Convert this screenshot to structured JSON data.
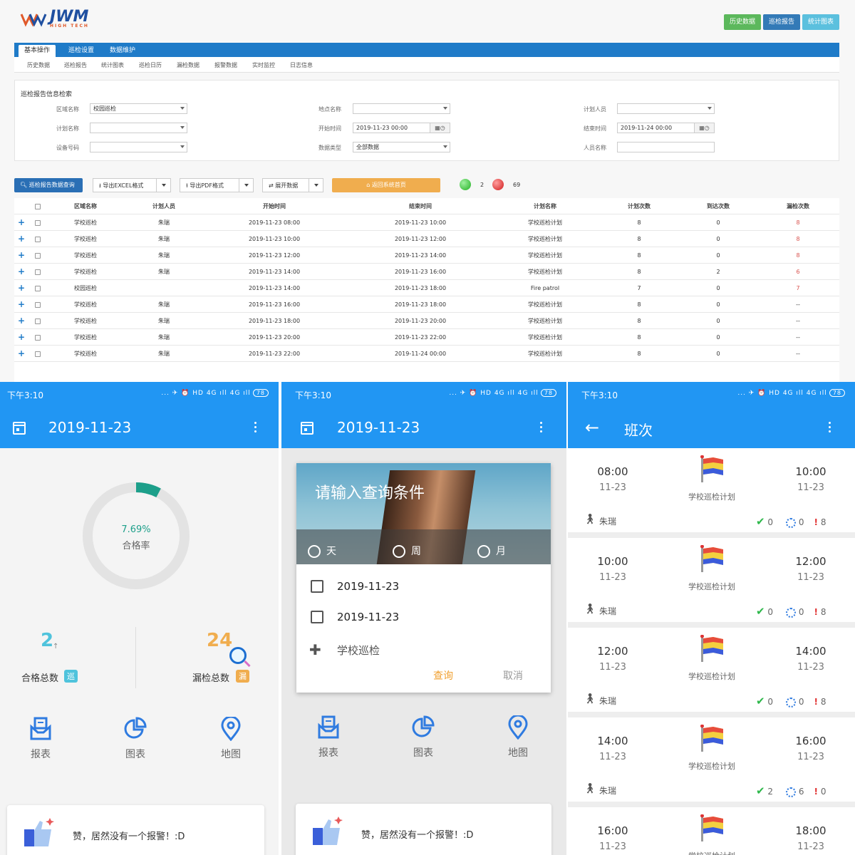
{
  "desktop": {
    "logo_text": "JWM",
    "logo_sub": "HIGH TECH",
    "top_buttons": [
      {
        "label": "历史数据",
        "color": "#5cb85c"
      },
      {
        "label": "巡检报告",
        "color": "#337ab7"
      },
      {
        "label": "统计图表",
        "color": "#5bc0de"
      }
    ],
    "nav_tabs": [
      "基本操作",
      "巡检设置",
      "数据维护"
    ],
    "sub_nav": [
      "历史数据",
      "巡检报告",
      "统计图表",
      "巡检日历",
      "漏检数据",
      "报警数据",
      "实时监控",
      "日志信息"
    ],
    "search": {
      "title": "巡检报告信息检索",
      "area_label": "区域名称",
      "area_value": "校园巡检",
      "plan_label": "计划名称",
      "plan_value": "",
      "device_label": "设备号码",
      "device_value": "",
      "location_label": "地点名称",
      "location_value": "",
      "start_label": "开始时间",
      "start_value": "2019-11-23 00:00",
      "type_label": "数据类型",
      "type_value": "全部数据",
      "planner_label": "计划人员",
      "planner_value": "",
      "end_label": "结束时间",
      "end_value": "2019-11-24 00:00",
      "person_label": "人员名称",
      "person_value": ""
    },
    "toolbar": {
      "query": "巡检报告数据查询",
      "excel": "导出EXCEL格式",
      "pdf": "导出PDF格式",
      "expand": "展开数据",
      "home": "返回系统首页",
      "green_count": "2",
      "red_count": "69"
    },
    "table": {
      "headers": [
        "区域名称",
        "计划人员",
        "开始时间",
        "结束时间",
        "计划名称",
        "计划次数",
        "到达次数",
        "漏检次数"
      ],
      "rows": [
        [
          "学校巡检",
          "朱瑞",
          "2019-11-23 08:00",
          "2019-11-23 10:00",
          "学校巡检计划",
          "8",
          "0",
          "8"
        ],
        [
          "学校巡检",
          "朱瑞",
          "2019-11-23 10:00",
          "2019-11-23 12:00",
          "学校巡检计划",
          "8",
          "0",
          "8"
        ],
        [
          "学校巡检",
          "朱瑞",
          "2019-11-23 12:00",
          "2019-11-23 14:00",
          "学校巡检计划",
          "8",
          "0",
          "8"
        ],
        [
          "学校巡检",
          "朱瑞",
          "2019-11-23 14:00",
          "2019-11-23 16:00",
          "学校巡检计划",
          "8",
          "2",
          "6"
        ],
        [
          "校园巡检",
          "",
          "2019-11-23 14:00",
          "2019-11-23 18:00",
          "Fire patrol",
          "7",
          "0",
          "7"
        ],
        [
          "学校巡检",
          "朱瑞",
          "2019-11-23 16:00",
          "2019-11-23 18:00",
          "学校巡检计划",
          "8",
          "0",
          "--"
        ],
        [
          "学校巡检",
          "朱瑞",
          "2019-11-23 18:00",
          "2019-11-23 20:00",
          "学校巡检计划",
          "8",
          "0",
          "--"
        ],
        [
          "学校巡检",
          "朱瑞",
          "2019-11-23 20:00",
          "2019-11-23 22:00",
          "学校巡检计划",
          "8",
          "0",
          "--"
        ],
        [
          "学校巡检",
          "朱瑞",
          "2019-11-23 22:00",
          "2019-11-24 00:00",
          "学校巡检计划",
          "8",
          "0",
          "--"
        ]
      ]
    }
  },
  "status_time": "下午3:10",
  "status_icons": "... ✈ ⏰ HD 4G ıll 4G ıll",
  "battery": "78",
  "phone1": {
    "title": "2019-11-23",
    "rate": "7.69%",
    "rate_label": "合格率",
    "rate_fraction": 0.0769,
    "pass_count": "2",
    "pass_label": "合格总数",
    "pass_badge": "巡",
    "miss_count": "24",
    "miss_label": "漏检总数",
    "miss_badge": "漏"
  },
  "nav_icons": [
    "报表",
    "图表",
    "地图"
  ],
  "alert_text": "赞，居然没有一个报警！:D",
  "phone2": {
    "title": "2019-11-23",
    "card_title": "请输入查询条件",
    "options": [
      "天",
      "周",
      "月"
    ],
    "date1": "2019-11-23",
    "date2": "2019-11-23",
    "area": "学校巡检",
    "confirm": "查询",
    "cancel": "取消"
  },
  "phone3": {
    "title": "班次",
    "shifts": [
      {
        "start": "08:00",
        "start_date": "11-23",
        "end": "10:00",
        "end_date": "11-23",
        "plan": "学校巡检计划",
        "user": "朱瑞",
        "ok": "0",
        "pending": "0",
        "missed": "8"
      },
      {
        "start": "10:00",
        "start_date": "11-23",
        "end": "12:00",
        "end_date": "11-23",
        "plan": "学校巡检计划",
        "user": "朱瑞",
        "ok": "0",
        "pending": "0",
        "missed": "8"
      },
      {
        "start": "12:00",
        "start_date": "11-23",
        "end": "14:00",
        "end_date": "11-23",
        "plan": "学校巡检计划",
        "user": "朱瑞",
        "ok": "0",
        "pending": "0",
        "missed": "8"
      },
      {
        "start": "14:00",
        "start_date": "11-23",
        "end": "16:00",
        "end_date": "11-23",
        "plan": "学校巡检计划",
        "user": "朱瑞",
        "ok": "2",
        "pending": "6",
        "missed": "0"
      },
      {
        "start": "16:00",
        "start_date": "11-23",
        "end": "18:00",
        "end_date": "11-23",
        "plan": "学校巡检计划",
        "user": "",
        "ok": "",
        "pending": "",
        "missed": ""
      }
    ]
  }
}
